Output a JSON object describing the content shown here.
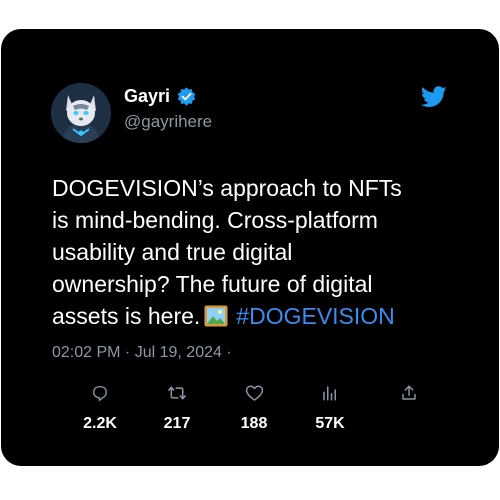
{
  "tweet": {
    "author_name": "Gayri",
    "author_handle": "@gayrihere",
    "text_line1": "DOGEVISION’s approach to NFTs",
    "text_line2": "is mind-bending. Cross-platform",
    "text_line3": "usability and true digital",
    "text_line4": "ownership? The future of digital",
    "text_line5": "assets is here.",
    "hashtag": "#DOGEVISION",
    "timestamp": "02:02 PM · Jul 19, 2024 ·"
  },
  "actions": {
    "replies": "2.2K",
    "retweets": "217",
    "likes": "188",
    "views": "57K"
  },
  "icons": {
    "verified": "verified-badge-icon",
    "brand": "twitter-bird-icon",
    "reply": "reply-icon",
    "retweet": "retweet-icon",
    "like": "heart-icon",
    "views": "views-bar-icon",
    "share": "share-icon",
    "emoji": "framed-picture-emoji-icon"
  },
  "colors": {
    "background": "#000000",
    "text": "#ffffff",
    "muted": "#8b98a5",
    "accent": "#1d9bf0",
    "hashtag": "#3b8cf0"
  }
}
